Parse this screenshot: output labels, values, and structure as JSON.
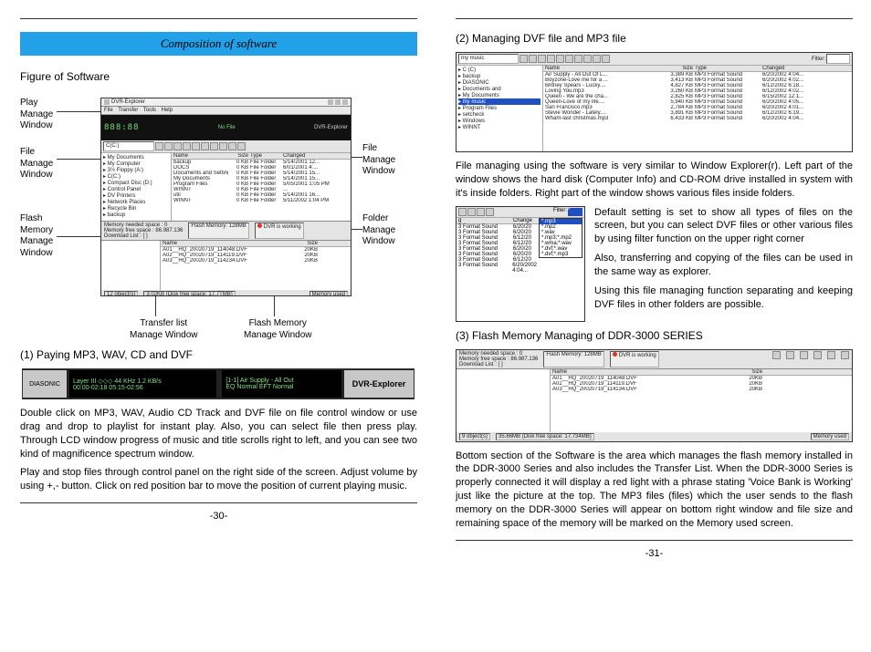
{
  "left": {
    "heading": "Composition of software",
    "subhead": "Figure of Software",
    "labels": {
      "play_manage": "Play\nManage\nWindow",
      "file_manage_l": "File\nManage\nWindow",
      "flash_manage": "Flash\nMemory\nManage\nWindow",
      "file_manage_r": "File\nManage\nWindow",
      "folder_manage": "Folder\nManage\nWindow",
      "transfer_window": "Transfer list\nManage Window",
      "flash_window": "Flash Memory\nManage Window"
    },
    "main_window": {
      "title": "DVR-Explorer",
      "menus": [
        "File",
        "Transfer",
        "Tools",
        "Help"
      ],
      "lcd_digits": "888:88",
      "lcd_text": "No File",
      "brand": "DVR-Explorer",
      "address": "C(C:)",
      "tree": [
        "▸ My Documents",
        "▸ My Computer",
        "  ▸ 3½ Floppy (A:)",
        "  ▸ C(C:)",
        "  ▸ Compact Disc (D:)",
        "  ▸ Control Panel",
        "  ▸ DV Printers",
        "  ▸ Network Places",
        "▸ Recycle Bin",
        "▸ backup"
      ],
      "file_cols": [
        "Name",
        "Size",
        "Type",
        "Changed"
      ],
      "files": [
        {
          "n": "backup",
          "s": "0 KB",
          "t": "File Folder",
          "c": "5/14/2001 12..."
        },
        {
          "n": "DOCS",
          "s": "0 KB",
          "t": "File Folder",
          "c": "6/01/2001 4:..."
        },
        {
          "n": "Documents and Settings",
          "s": "0 KB",
          "t": "File Folder",
          "c": "5/14/2001 15..."
        },
        {
          "n": "My Documents",
          "s": "0 KB",
          "t": "File Folder",
          "c": "5/14/2001 15..."
        },
        {
          "n": "Program Files",
          "s": "0 KB",
          "t": "File Folder",
          "c": "5/05/2001 1:05 PM"
        },
        {
          "n": "WINNT",
          "s": "0 KB",
          "t": "File Folder",
          "c": "..."
        },
        {
          "n": "util",
          "s": "0 KB",
          "t": "File Folder",
          "c": "5/14/2001 16..."
        },
        {
          "n": "WINNT",
          "s": "0 KB",
          "t": "File Folder",
          "c": "5/11/2002 1:04 PM"
        }
      ],
      "mem_needed": "Memory needed space : 0",
      "mem_free": "Memory free space :     86.987.136",
      "download": "Download List : [    ]",
      "flash_mem": "Flash Memory: 128MB",
      "dvr_working": "DVR is working",
      "flash_cols": [
        "Name",
        "Size"
      ],
      "flash_files": [
        {
          "n": "A01__HQ_20020719_114048.DVF",
          "s": "20KB"
        },
        {
          "n": "A02__HQ_20020719_114119.DVF",
          "s": "20KB"
        },
        {
          "n": "A03__HQ_20020719_114234.DVF",
          "s": "20KB"
        }
      ],
      "status_left": "12 object(s)",
      "status_mid": "3.02KB (Disk free space: 17.7TMB)",
      "status_right": "Memory used"
    },
    "section1_title": "(1) Paying MP3, WAV, CD and DVF",
    "player": {
      "brand_left": "DIASONIC",
      "line1": "Layer III ◇◇◇   44 KHz   1.2 KB/s",
      "line2": "00:00-02:18   05:15-02:56",
      "line3": "[1-1] Air Supply - All Out",
      "line4": "EQ Normal   EFT Normal",
      "brand_right": "DVR-Explorer"
    },
    "paras": [
      "Double click on MP3, WAV, Audio CD Track and DVF file on file control window or use drag and drop to playlist for instant play. Also, you can select file then press play. Through LCD window progress of music and title scrolls right to left, and you can see two kind of magnificence spectrum window.",
      "Play and stop files through control panel on the right side of the screen. Adjust volume by using +,- button. Click on red position bar to move the position of current playing music."
    ],
    "pagenum": "-30-"
  },
  "right": {
    "section2_title": "(2) Managing DVF file and MP3 file",
    "fig2": {
      "address": "my music",
      "filter_label": "Filter:",
      "tree": [
        "▸ C (C)",
        "  ▸ backup",
        "  ▸ DIASONIC",
        "  ▸ Documents and",
        "  ▸ My Documents",
        "    ▸ my music",
        "  ▸ Program Files",
        "  ▸ setcheck",
        "  ▸ Windows",
        "  ▸ WINNT"
      ],
      "cols": [
        "Name",
        "Size",
        "Type",
        "Changed"
      ],
      "rows": [
        {
          "n": "Air Supply - All Out Of L...",
          "s": "3,389 KB",
          "t": "MP3 Format Sound",
          "c": "6/20/2002 4:04..."
        },
        {
          "n": "Boyzone-Love me for a ...",
          "s": "3,413 KB",
          "t": "MP3 Format Sound",
          "c": "6/20/2002 4:02..."
        },
        {
          "n": "Britney Spears - Lucky....",
          "s": "4,827 KB",
          "t": "MP3 Format Sound",
          "c": "6/12/2002 6:18..."
        },
        {
          "n": "Loving You.mp3",
          "s": "3,260 KB",
          "t": "MP3 Format Sound",
          "c": "6/12/2002 4:02..."
        },
        {
          "n": "Queen - We are the cha...",
          "s": "2,825 KB",
          "t": "MP3 Format Sound",
          "c": "6/15/2002 12:1..."
        },
        {
          "n": "Queen-Love of my life....",
          "s": "5,940 KB",
          "t": "MP3 Format Sound",
          "c": "6/20/2002 4:05..."
        },
        {
          "n": "San Francisco.mp3",
          "s": "2,784 KB",
          "t": "MP3 Format Sound",
          "c": "6/20/2002 4:01..."
        },
        {
          "n": "Stevie Wonder - Lately....",
          "s": "3,891 KB",
          "t": "MP3 Format Sound",
          "c": "6/12/2002 6:19..."
        },
        {
          "n": "Wham-last christmas.mp3",
          "s": "6,433 KB",
          "t": "MP3 Format Sound",
          "c": "6/20/2002 4:04..."
        }
      ]
    },
    "para2a": "File managing using the software is very similar to Window Explorer(r). Left part of the window shows the hard disk (Computer Info) and CD-ROM drive installed in system with it's inside folders. Right part of the window shows various files inside folders.",
    "fig3": {
      "filter_label": "Filter:",
      "cols": [
        "g",
        "Change"
      ],
      "rows": [
        {
          "t": "3 Format Sound",
          "c": "6/20/20"
        },
        {
          "t": "3 Format Sound",
          "c": "6/20/20"
        },
        {
          "t": "3 Format Sound",
          "c": "6/12/20"
        },
        {
          "t": "3 Format Sound",
          "c": "6/12/20"
        },
        {
          "t": "3 Format Sound",
          "c": "6/20/20"
        },
        {
          "t": "3 Format Sound",
          "c": "6/20/20"
        },
        {
          "t": "3 Format Sound",
          "c": "6/12/20"
        },
        {
          "t": "3 Format Sound",
          "c": "6/20/2002 4:04..."
        }
      ],
      "options": [
        "*.mp3",
        "*.mp2",
        "*.wav",
        "*.mp3;*.mp2",
        "*.wma;*.wav",
        "*.dvf;*.wav",
        "*.dvf;*.mp3"
      ],
      "sel": "*"
    },
    "para2b": [
      "Default setting is set to show all types of files on the screen, but you can select DVF files or other various files by using filter function on the upper right corner",
      "Also, transferring and copying of the files can be used in the same way as explorer.",
      "Using this file managing function separating and keeping DVF files in other folders are possible."
    ],
    "section3_title": "(3) Flash Memory Managing of DDR-3000 SERIES",
    "fig4": {
      "mem_needed": "Memory needed space : 0",
      "mem_free": "Memory free space :        86.987.136",
      "download": "Download List : [    ]",
      "flash_mem": "Flash Memory: 128MB",
      "dvr_working": "DVR is working",
      "cols": [
        "Name",
        "Size"
      ],
      "rows": [
        {
          "n": "A01__HQ_20020719_114048.DVF",
          "s": "20KB"
        },
        {
          "n": "A02__HQ_20020719_114119.DVF",
          "s": "20KB"
        },
        {
          "n": "A03__HQ_20020719_114134.DVF",
          "s": "20KB"
        }
      ],
      "status_left": "9 object(s)",
      "status_mid": "35.66MB (Disk free space: 17,734MB)",
      "status_right": "Memory used"
    },
    "para3": "Bottom section of the Software is the area which manages the flash memory installed in the DDR-3000 Series and also includes the Transfer List. When the DDR-3000 Series is properly connected it will display a red light with a phrase stating 'Voice Bank is Working' just like the picture at the top. The MP3 files (files) which the user sends to the flash memory on the DDR-3000 Series will appear on bottom right window and file size and remaining space of the memory will be marked on the Memory used screen.",
    "pagenum": "-31-"
  }
}
